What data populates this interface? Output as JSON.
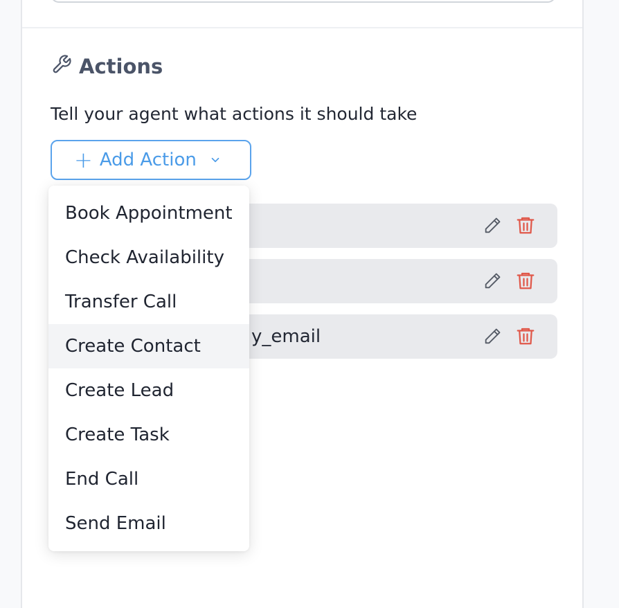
{
  "section": {
    "title": "Actions",
    "icon": "wrench-icon",
    "description": "Tell your agent what actions it should take"
  },
  "add_button": {
    "label": "Add Action",
    "icon": "plus-icon"
  },
  "actions": [
    {
      "name": ""
    },
    {
      "name": ""
    },
    {
      "name": "y_email"
    }
  ],
  "dropdown": {
    "items": [
      {
        "label": "Book Appointment"
      },
      {
        "label": "Check Availability"
      },
      {
        "label": "Transfer Call"
      },
      {
        "label": "Create Contact"
      },
      {
        "label": "Create Lead"
      },
      {
        "label": "Create Task"
      },
      {
        "label": "End Call"
      },
      {
        "label": "Send Email"
      }
    ],
    "hovered": "Create Contact"
  },
  "colors": {
    "accent": "#4a9be8",
    "delete": "#e0584a",
    "row_bg": "#e9eaed"
  }
}
